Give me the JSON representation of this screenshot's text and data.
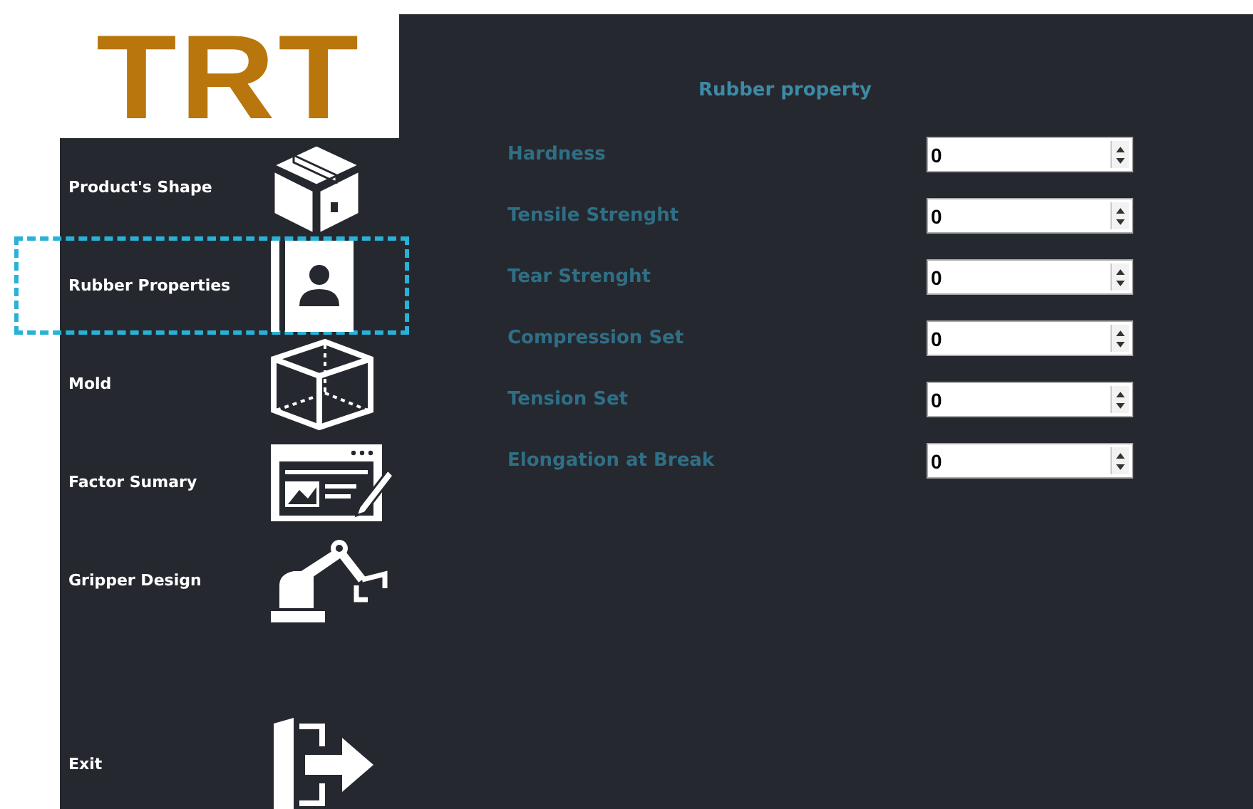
{
  "logo": {
    "text": "TRT"
  },
  "sidebar": {
    "items": [
      {
        "label": "Product's Shape",
        "selected": false
      },
      {
        "label": "Rubber Properties",
        "selected": true
      },
      {
        "label": "Mold",
        "selected": false
      },
      {
        "label": "Factor Sumary",
        "selected": false
      },
      {
        "label": "Gripper Design",
        "selected": false
      },
      {
        "label": "Exit",
        "selected": false
      }
    ]
  },
  "form": {
    "title": "Rubber property",
    "fields": [
      {
        "label": "Hardness",
        "value": "0"
      },
      {
        "label": "Tensile Strenght",
        "value": "0"
      },
      {
        "label": "Tear Strenght",
        "value": "0"
      },
      {
        "label": "Compression Set",
        "value": "0"
      },
      {
        "label": "Tension Set",
        "value": "0"
      },
      {
        "label": "Elongation at Break",
        "value": "0"
      }
    ]
  }
}
